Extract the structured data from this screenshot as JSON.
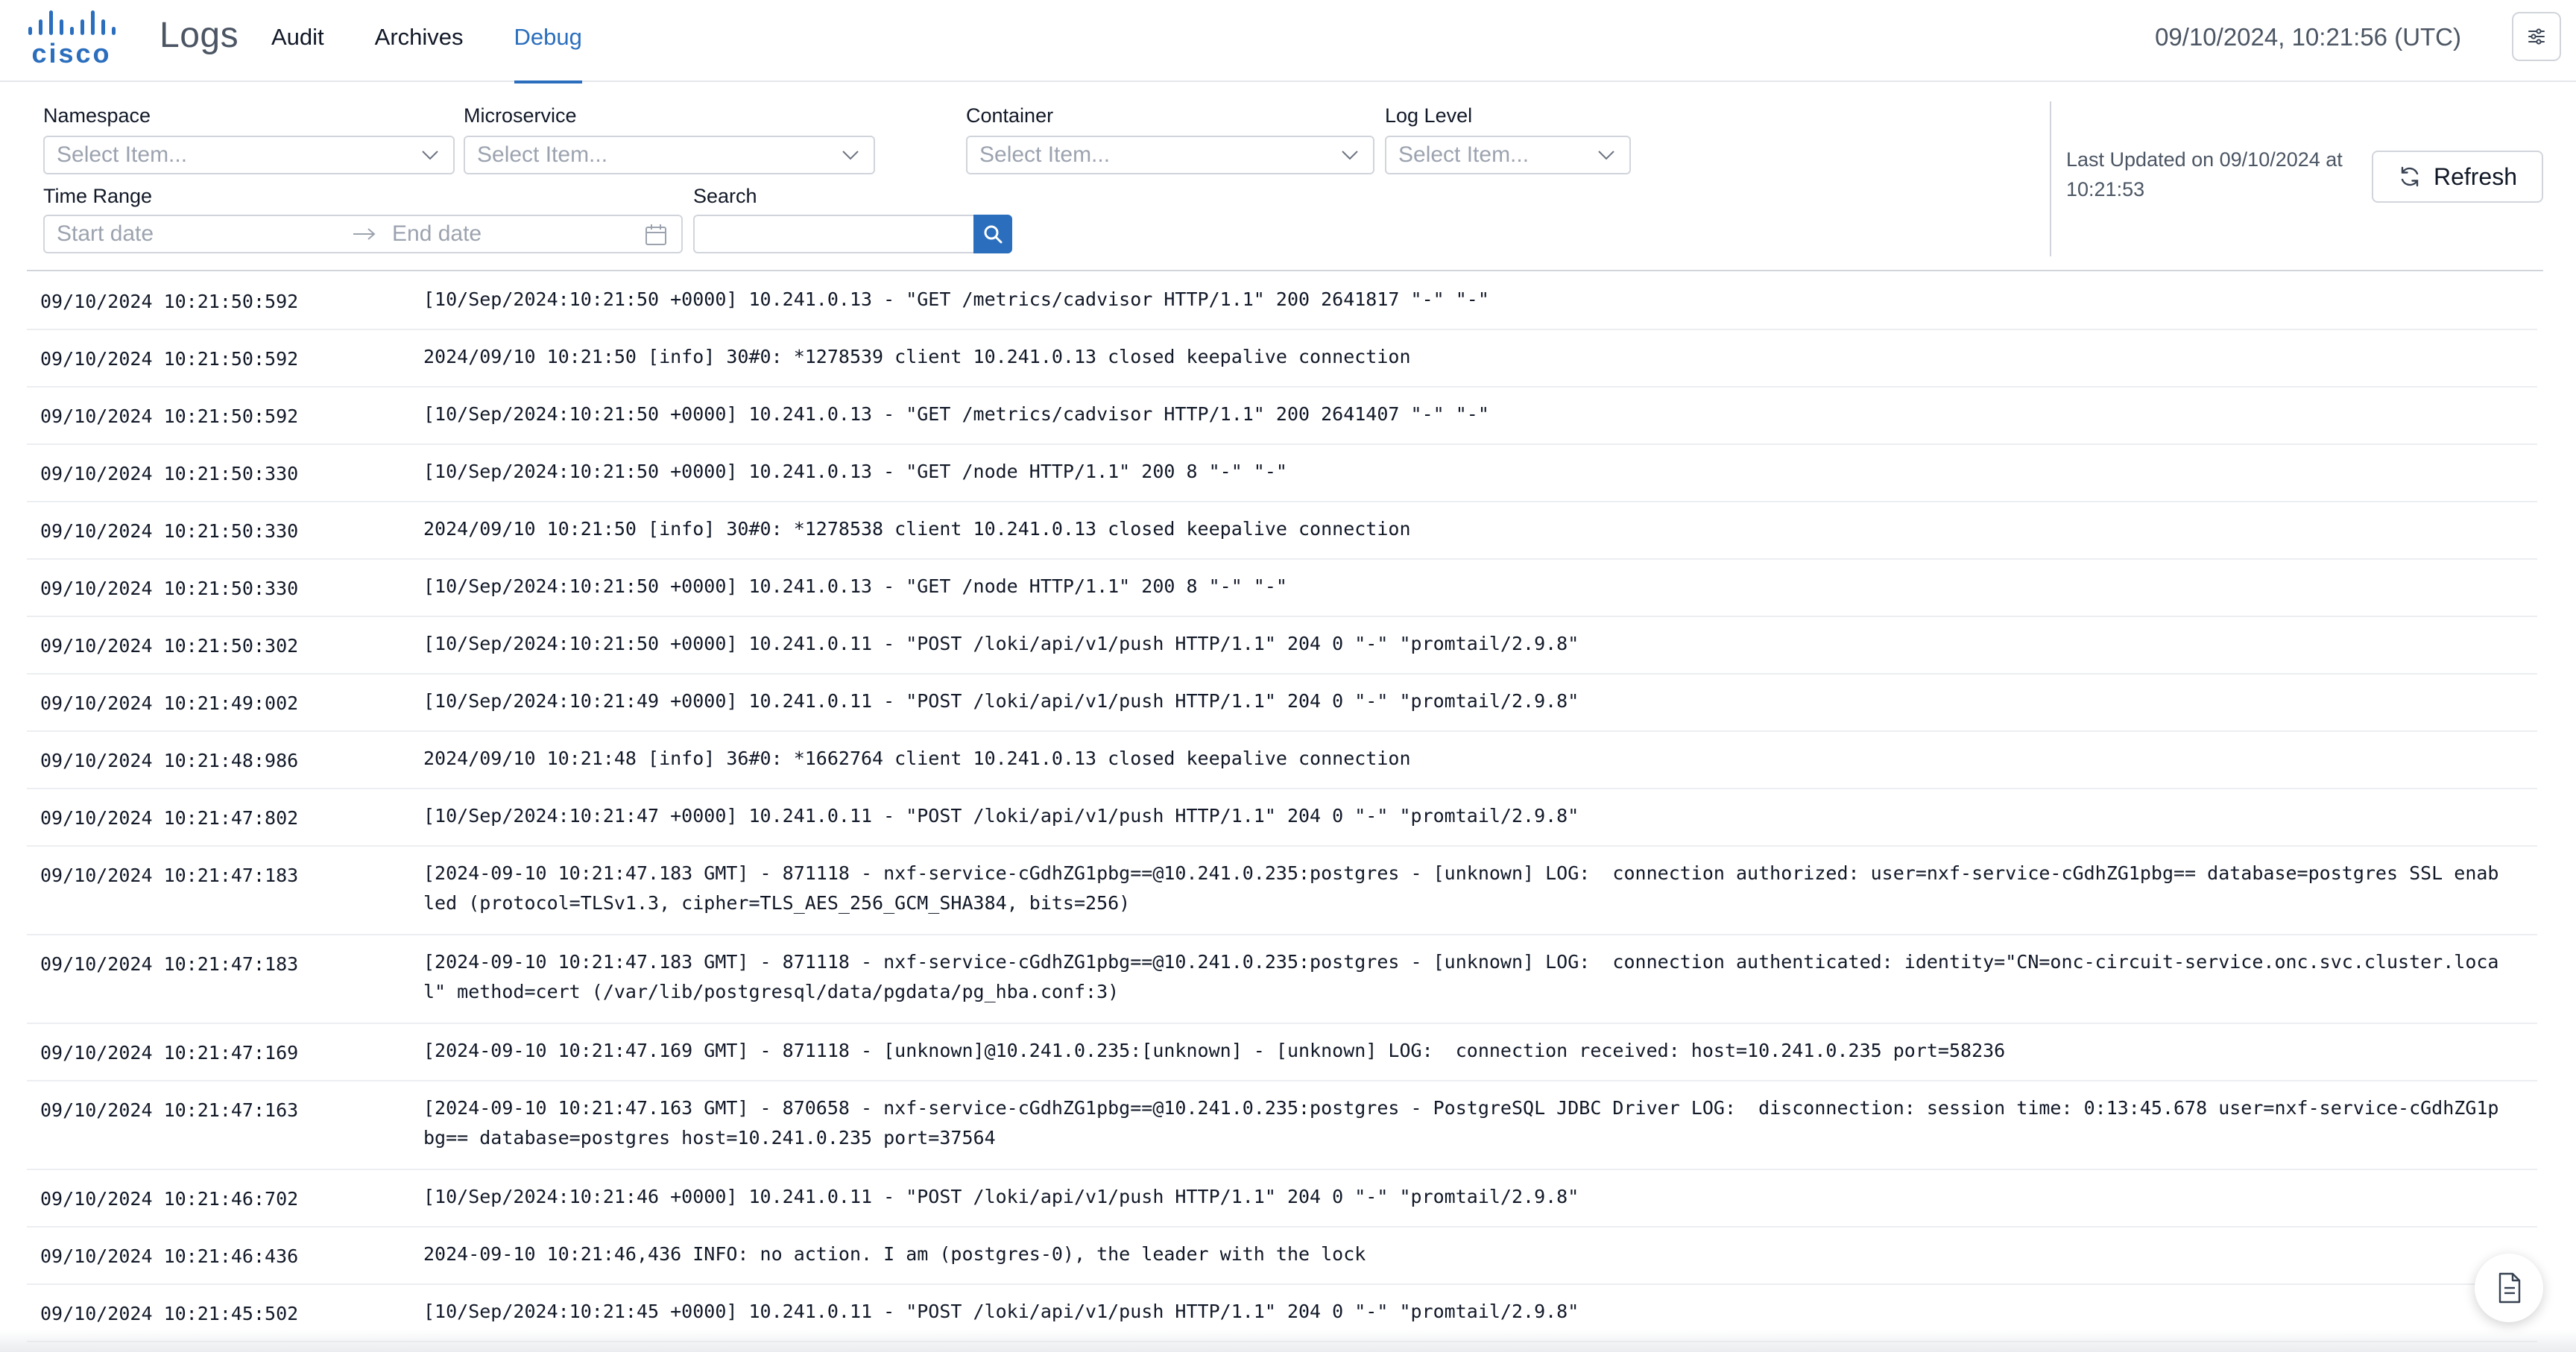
{
  "header": {
    "brand": "cisco",
    "app_title": "Logs",
    "tabs": [
      {
        "label": "Audit",
        "active": false
      },
      {
        "label": "Archives",
        "active": false
      },
      {
        "label": "Debug",
        "active": true
      }
    ],
    "datetime": "09/10/2024, 10:21:56 (UTC)",
    "settings_icon": "sliders-icon"
  },
  "filters": {
    "namespace": {
      "label": "Namespace",
      "placeholder": "Select Item..."
    },
    "microservice": {
      "label": "Microservice",
      "placeholder": "Select Item..."
    },
    "container": {
      "label": "Container",
      "placeholder": "Select Item..."
    },
    "log_level": {
      "label": "Log Level",
      "placeholder": "Select Item..."
    },
    "time_range": {
      "label": "Time Range",
      "start_placeholder": "Start date",
      "end_placeholder": "End date"
    },
    "search": {
      "label": "Search",
      "value": ""
    },
    "last_updated": "Last Updated on 09/10/2024 at 10:21:53",
    "refresh_label": "Refresh"
  },
  "colors": {
    "accent": "#2a6ebd",
    "border": "#d1d5db"
  },
  "logs": [
    {
      "ts": "09/10/2024 10:21:50:592",
      "msg": "[10/Sep/2024:10:21:50 +0000] 10.241.0.13 - \"GET /metrics/cadvisor HTTP/1.1\" 200 2641817 \"-\" \"-\"",
      "lines": 1
    },
    {
      "ts": "09/10/2024 10:21:50:592",
      "msg": "2024/09/10 10:21:50 [info] 30#0: *1278539 client 10.241.0.13 closed keepalive connection",
      "lines": 1
    },
    {
      "ts": "09/10/2024 10:21:50:592",
      "msg": "[10/Sep/2024:10:21:50 +0000] 10.241.0.13 - \"GET /metrics/cadvisor HTTP/1.1\" 200 2641407 \"-\" \"-\"",
      "lines": 1
    },
    {
      "ts": "09/10/2024 10:21:50:330",
      "msg": "[10/Sep/2024:10:21:50 +0000] 10.241.0.13 - \"GET /node HTTP/1.1\" 200 8 \"-\" \"-\"",
      "lines": 1
    },
    {
      "ts": "09/10/2024 10:21:50:330",
      "msg": "2024/09/10 10:21:50 [info] 30#0: *1278538 client 10.241.0.13 closed keepalive connection",
      "lines": 1
    },
    {
      "ts": "09/10/2024 10:21:50:330",
      "msg": "[10/Sep/2024:10:21:50 +0000] 10.241.0.13 - \"GET /node HTTP/1.1\" 200 8 \"-\" \"-\"",
      "lines": 1
    },
    {
      "ts": "09/10/2024 10:21:50:302",
      "msg": "[10/Sep/2024:10:21:50 +0000] 10.241.0.11 - \"POST /loki/api/v1/push HTTP/1.1\" 204 0 \"-\" \"promtail/2.9.8\"",
      "lines": 1
    },
    {
      "ts": "09/10/2024 10:21:49:002",
      "msg": "[10/Sep/2024:10:21:49 +0000] 10.241.0.11 - \"POST /loki/api/v1/push HTTP/1.1\" 204 0 \"-\" \"promtail/2.9.8\"",
      "lines": 1
    },
    {
      "ts": "09/10/2024 10:21:48:986",
      "msg": "2024/09/10 10:21:48 [info] 36#0: *1662764 client 10.241.0.13 closed keepalive connection",
      "lines": 1
    },
    {
      "ts": "09/10/2024 10:21:47:802",
      "msg": "[10/Sep/2024:10:21:47 +0000] 10.241.0.11 - \"POST /loki/api/v1/push HTTP/1.1\" 204 0 \"-\" \"promtail/2.9.8\"",
      "lines": 1
    },
    {
      "ts": "09/10/2024 10:21:47:183",
      "msg": "[2024-09-10 10:21:47.183 GMT] - 871118 - nxf-service-cGdhZG1pbg==@10.241.0.235:postgres - [unknown] LOG:  connection authorized: user=nxf-service-cGdhZG1pbg== database=postgres SSL enabled (protocol=TLSv1.3, cipher=TLS_AES_256_GCM_SHA384, bits=256)",
      "lines": 2
    },
    {
      "ts": "09/10/2024 10:21:47:183",
      "msg": "[2024-09-10 10:21:47.183 GMT] - 871118 - nxf-service-cGdhZG1pbg==@10.241.0.235:postgres - [unknown] LOG:  connection authenticated: identity=\"CN=onc-circuit-service.onc.svc.cluster.local\" method=cert (/var/lib/postgresql/data/pgdata/pg_hba.conf:3)",
      "lines": 2
    },
    {
      "ts": "09/10/2024 10:21:47:169",
      "msg": "[2024-09-10 10:21:47.169 GMT] - 871118 - [unknown]@10.241.0.235:[unknown] - [unknown] LOG:  connection received: host=10.241.0.235 port=58236",
      "lines": 1
    },
    {
      "ts": "09/10/2024 10:21:47:163",
      "msg": "[2024-09-10 10:21:47.163 GMT] - 870658 - nxf-service-cGdhZG1pbg==@10.241.0.235:postgres - PostgreSQL JDBC Driver LOG:  disconnection: session time: 0:13:45.678 user=nxf-service-cGdhZG1pbg== database=postgres host=10.241.0.235 port=37564",
      "lines": 2
    },
    {
      "ts": "09/10/2024 10:21:46:702",
      "msg": "[10/Sep/2024:10:21:46 +0000] 10.241.0.11 - \"POST /loki/api/v1/push HTTP/1.1\" 204 0 \"-\" \"promtail/2.9.8\"",
      "lines": 1
    },
    {
      "ts": "09/10/2024 10:21:46:436",
      "msg": "2024-09-10 10:21:46,436 INFO: no action. I am (postgres-0), the leader with the lock",
      "lines": 1
    },
    {
      "ts": "09/10/2024 10:21:45:502",
      "msg": "[10/Sep/2024:10:21:45 +0000] 10.241.0.11 - \"POST /loki/api/v1/push HTTP/1.1\" 204 0 \"-\" \"promtail/2.9.8\"",
      "lines": 1
    }
  ],
  "fab_icon": "document-icon"
}
